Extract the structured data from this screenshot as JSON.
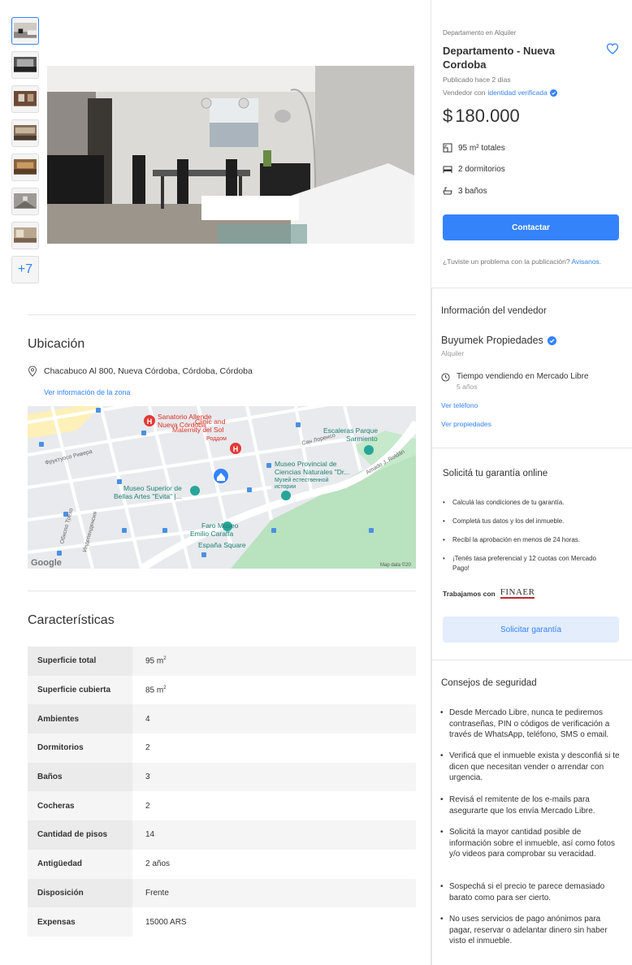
{
  "gallery": {
    "more_label": "+7"
  },
  "location": {
    "title": "Ubicación",
    "address": "Chacabuco Al 800, Nueva Córdoba, Córdoba, Córdoba",
    "zone_link": "Ver información de la zona",
    "map": {
      "labels": {
        "hospital": "Sanatorio Allende\nNueva Córdoba",
        "clinic": "Clinic and\nMaternity del Sol",
        "clinic_ru": "Роддом",
        "escaleras": "Escaleras Parque\nSarmiento",
        "san_lorenzo": "Сан Лоренсо",
        "frutuoso": "Фруктуосо Ривера",
        "museo_cn": "Museo Provincial de\nCiencias Naturales \"Dr...",
        "museo_cn_ru": "Музей естественной\nистории",
        "bellas": "Museo Superior de\nBellas Artes \"Evita\" |...",
        "faro": "Faro Museo\nEmilio Caraffa",
        "espana": "España Square",
        "amado": "Amado J. Roldán",
        "obispo": "Обиспо Трехо",
        "independencia": "Индепенденсия",
        "google": "Google",
        "mapdata": "Map data ©20"
      }
    }
  },
  "features": {
    "title": "Características",
    "rows": [
      {
        "k": "Superficie total",
        "v": "95 m",
        "sup": "2"
      },
      {
        "k": "Superficie cubierta",
        "v": "85 m",
        "sup": "2"
      },
      {
        "k": "Ambientes",
        "v": "4"
      },
      {
        "k": "Dormitorios",
        "v": "2"
      },
      {
        "k": "Baños",
        "v": "3"
      },
      {
        "k": "Cocheras",
        "v": "2"
      },
      {
        "k": "Cantidad de pisos",
        "v": "14"
      },
      {
        "k": "Antigüedad",
        "v": "2 años"
      },
      {
        "k": "Disposición",
        "v": "Frente"
      },
      {
        "k": "Expensas",
        "v": "15000 ARS"
      }
    ]
  },
  "listing": {
    "condition": "Departamento en Alquiler",
    "title": "Departamento - Nueva Cordoba",
    "published": "Publicado hace 2 días",
    "vendor_prefix": "Vendedor con",
    "vendor_link": "identidad verificada",
    "currency": "$",
    "price": "180.000",
    "attrs": {
      "surface": "95 m² totales",
      "bedrooms": "2 dormitorios",
      "baths": "3 baños"
    },
    "contact_btn": "Contactar",
    "problem_text": "¿Tuviste un problema con la publicación?",
    "problem_link": "Avisanos."
  },
  "seller": {
    "title": "Información del vendedor",
    "name": "Buyumek Propiedades",
    "type": "Alquiler",
    "tiempo_label": "Tiempo vendiendo en Mercado Libre",
    "tiempo_value": "5 años",
    "phone_link": "Ver teléfono",
    "props_link": "Ver propiedades"
  },
  "guarantee": {
    "title": "Solicitá tu garantía online",
    "bullets": [
      "Calculá las condiciones de tu garantía.",
      "Completá tus datos y los del inmueble.",
      "Recibí la aprobación en menos de 24 horas.",
      "¡Tenés tasa preferencial y 12 cuotas con Mercado Pago!"
    ],
    "trabajamos": "Trabajamos con",
    "partner": "FINAER",
    "btn": "Solicitar garantía"
  },
  "safety": {
    "title": "Consejos de seguridad",
    "tips": [
      "Desde Mercado Libre, nunca te pediremos contraseñas, PIN o códigos de verificación a través de WhatsApp, teléfono, SMS o email.",
      "Verificá que el inmueble exista y desconfiá si te dicen que necesitan vender o arrendar con urgencia.",
      "Revisá el remitente de los e-mails para asegurarte que los envía Mercado Libre.",
      "Solicitá la mayor cantidad posible de información sobre el inmueble, así como fotos y/o videos para comprobar su veracidad.",
      "Sospechá si el precio te parece demasiado barato como para ser cierto.",
      "No uses servicios de pago anónimos para pagar, reservar o adelantar dinero sin haber visto el inmueble."
    ]
  },
  "colors": {
    "accent": "#3483fa",
    "map_green": "#b8e0bd",
    "map_road": "#ffffff",
    "map_yellow": "#fdf0b8"
  }
}
